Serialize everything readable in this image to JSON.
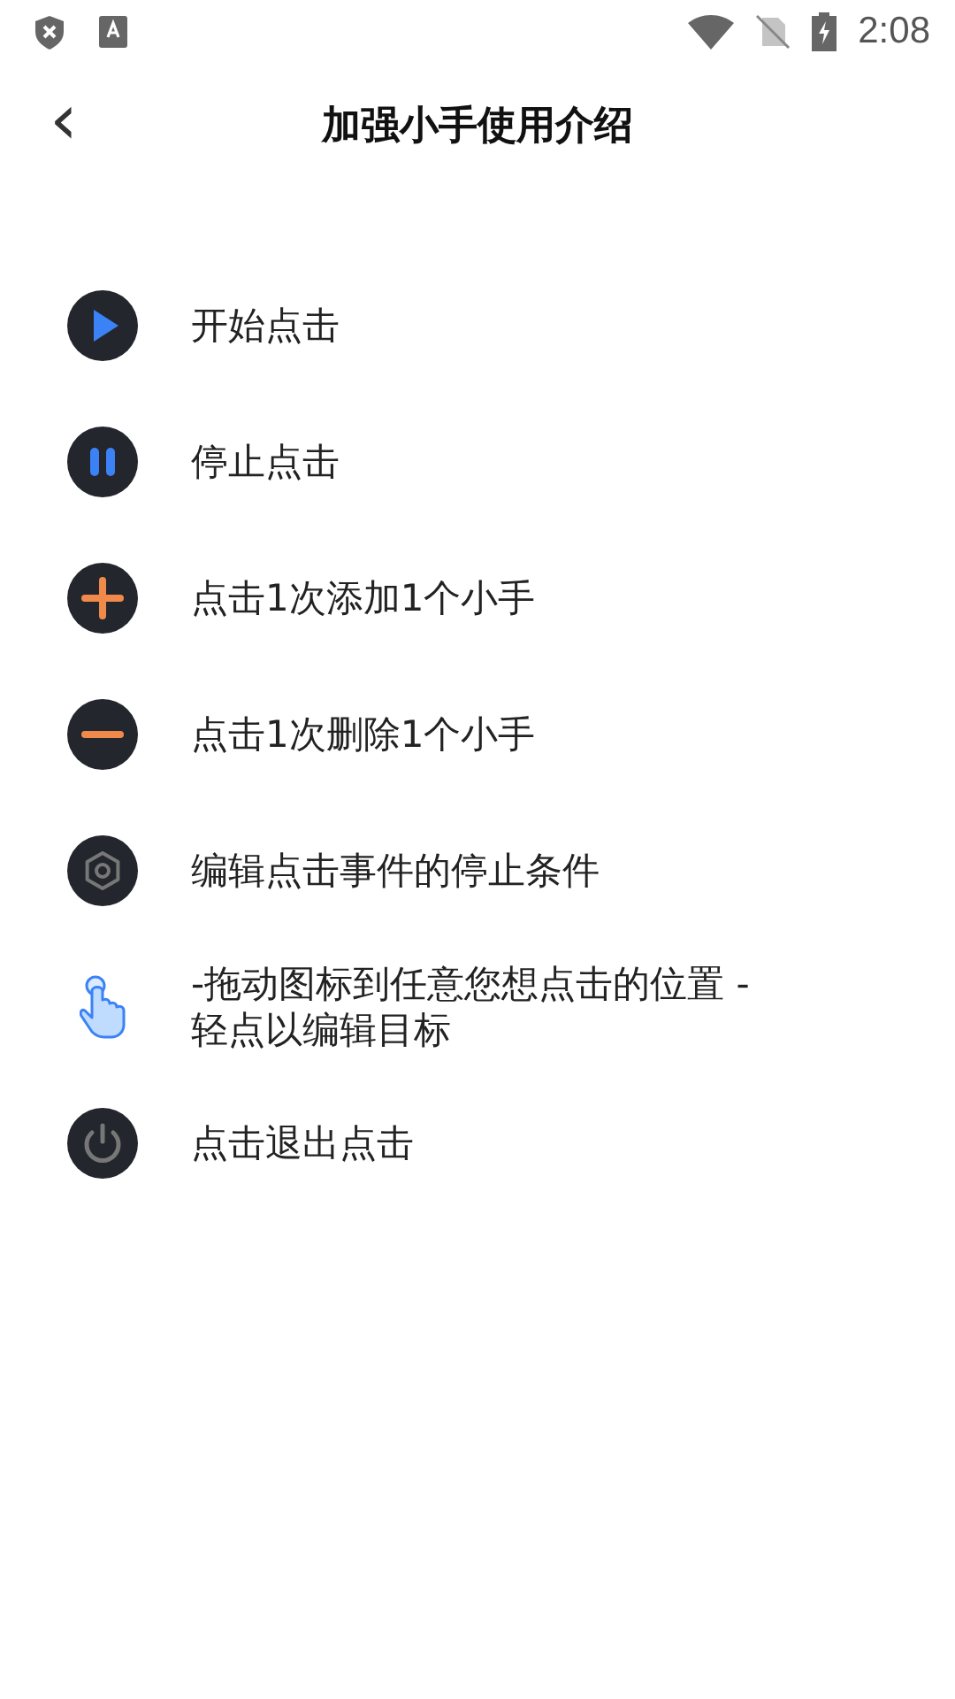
{
  "status_bar": {
    "time": "2:08"
  },
  "header": {
    "back": "‹",
    "title": "加强小手使用介绍"
  },
  "items": [
    {
      "kind": "play",
      "lines": [
        "开始点击"
      ]
    },
    {
      "kind": "pause",
      "lines": [
        "停止点击"
      ]
    },
    {
      "kind": "add",
      "lines": [
        "点击1次添加1个小手"
      ]
    },
    {
      "kind": "remove",
      "lines": [
        "点击1次删除1个小手"
      ]
    },
    {
      "kind": "settings",
      "lines": [
        "编辑点击事件的停止条件"
      ]
    },
    {
      "kind": "hand",
      "lines": [
        "-拖动图标到任意您想点击的位置 -",
        "轻点以编辑目标"
      ]
    },
    {
      "kind": "power",
      "lines": [
        "点击退出点击"
      ]
    }
  ]
}
